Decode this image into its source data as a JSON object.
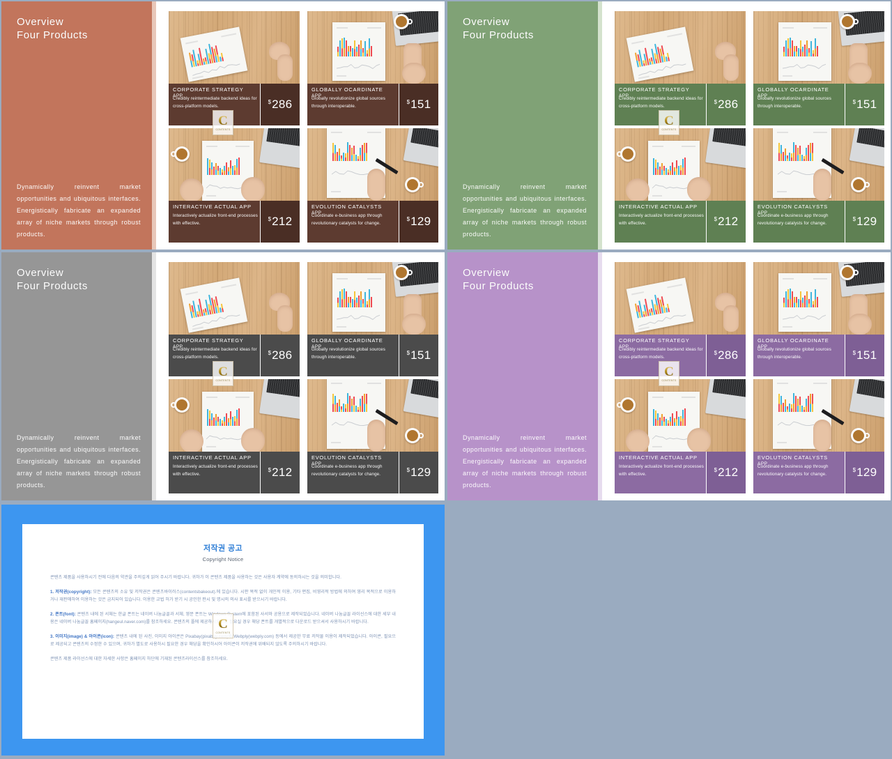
{
  "slides": [
    {
      "name": "slide-terracotta",
      "panel_color": "#c2755c",
      "edge_color": "#e8c7b9",
      "strip_color": "#5d3b30",
      "price_color": "#4a2e25",
      "title": "Overview\nFour Products",
      "body": "Dynamically reinvent market opportunities and ubiquitous interfaces. Energistically fabricate an expanded array of niche markets through robust products."
    },
    {
      "name": "slide-green",
      "panel_color": "#80a276",
      "edge_color": "#d4e2cd",
      "strip_color": "#5f8053",
      "price_color": "#5f8053",
      "title": "Overview\nFour Products",
      "body": "Dynamically reinvent market opportunities and ubiquitous interfaces. Energistically fabricate an expanded array of niche markets through robust products."
    },
    {
      "name": "slide-gray",
      "panel_color": "#969696",
      "edge_color": "#e3e3e3",
      "strip_color": "#4b4b4b",
      "price_color": "#4b4b4b",
      "title": "Overview\nFour Products",
      "body": "Dynamically reinvent market opportunities and ubiquitous interfaces. Energistically fabricate an expanded array of niche markets through robust products."
    },
    {
      "name": "slide-purple",
      "panel_color": "#b792c9",
      "edge_color": "#e6dcee",
      "strip_color": "#8c6ba2",
      "price_color": "#7e5f95",
      "title": "Overview\nFour Products",
      "body": "Dynamically reinvent market opportunities and ubiquitous interfaces. Energistically fabricate an expanded array of niche markets through robust products."
    }
  ],
  "cards": [
    {
      "title": "CORPORATE STRATEGY",
      "app": "APP",
      "desc": "Credibly reintermediate backend ideas for cross-platform models.",
      "currency": "$",
      "price": "286"
    },
    {
      "title": "GLOBALLY OCARDINATE",
      "app": "APP",
      "desc": "Globally revolutionize global sources through interoperable.",
      "currency": "$",
      "price": "151"
    },
    {
      "title": "INTERACTIVE ACTUAL APP",
      "app": "",
      "desc": "Interactively actualize front-end processes with effective.",
      "currency": "$",
      "price": "212"
    },
    {
      "title": "EVOLUTION CATALYSTS",
      "app": "APP",
      "desc": "Coordinate e-business app through revolutionary catalysts for change.",
      "currency": "$",
      "price": "129"
    }
  ],
  "watermark": {
    "letter": "C",
    "caption": "CONTENTS"
  },
  "copyright": {
    "title": "저작권 공고",
    "subtitle": "Copyright Notice",
    "intro": "콘텐츠 제품을 사용하시기 전에 다음의 약관을 주의깊게 읽어 주시기 바랍니다. 귀하가 이 콘텐츠 제품을 사용하는 것은 사용자 계약에 동의하시는 것을 의미합니다.",
    "sections": [
      {
        "heading": "1. 저작권(copyright):",
        "text": " 모든 콘텐츠의 소유 및 저작권은 콘텐츠바이러스(contentsbakeout).에 있습니다. 시판 목적 없이 개인적 이용, 기타 편집, 비영리적 방법에 의하여 영리 목적으로 이용하거나 재판매하여 이용하는 것은 금지되어 있습니다. 이용한 교법 허가 받기 시 공인한 판시 및 명시의 의사 표시를 받으시기 바랍니다."
      },
      {
        "heading": "2. 폰트(font):",
        "text": " 콘텐츠 내에 된 서체는 한글 폰트는 네이버 나눔글꼴과 서체, 영문 폰트는 Windows System에 포함된 사서와 공용으로 제작되었습니다. 네이버 나눔글꼴 라이선스에 대한 세부 내용은 네이버 나눔글꼴 홈페이지(hangeul.naver.com)를 참조하세요. 콘텐츠의 폴에 제공하시오므로 필요실 경우 해당 폰트를 개별적으로 다운로드 받으셔서 사용하시기 바랍니다."
      },
      {
        "heading": "3. 이미지(image) & 아이콘(icon):",
        "text": " 콘텐츠 내에 된 사진, 이미지 아이콘은 Pixabay(pixabay.com)와 Webply(webply.com) 등에서 제공한 무료 저작물 이용이 제작되었습니다. 아이콘, 필요으로 제공되고 콘텐츠의 수정한 수 있으며, 귀하가 별도로 사용하시 필요한 경우 해당을 확인하시어 아이콘이 저작권에 위배되지 않도록 주의하시기 바랍니다."
      }
    ],
    "footer": "콘텐츠 제품 라이선스에 대한 자세한 사항은 홈페이지 하단에 기재된 콘텐츠라이선스를 참조하세요."
  }
}
